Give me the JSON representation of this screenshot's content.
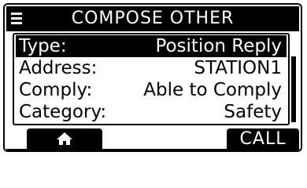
{
  "header": {
    "title": "COMPOSE OTHER",
    "menu_icon": "menu-icon"
  },
  "fields": [
    {
      "label": "Type:",
      "value": "Position Reply",
      "selected": true
    },
    {
      "label": "Address:",
      "value": "STATION1",
      "selected": false
    },
    {
      "label": "Comply:",
      "value": "Able to Comply",
      "selected": false
    },
    {
      "label": "Category:",
      "value": "Safety",
      "selected": false
    }
  ],
  "softkeys": {
    "left_icon": "home-icon",
    "right_label": "CALL"
  },
  "colors": {
    "foreground": "#000000",
    "background": "#ffffff"
  }
}
